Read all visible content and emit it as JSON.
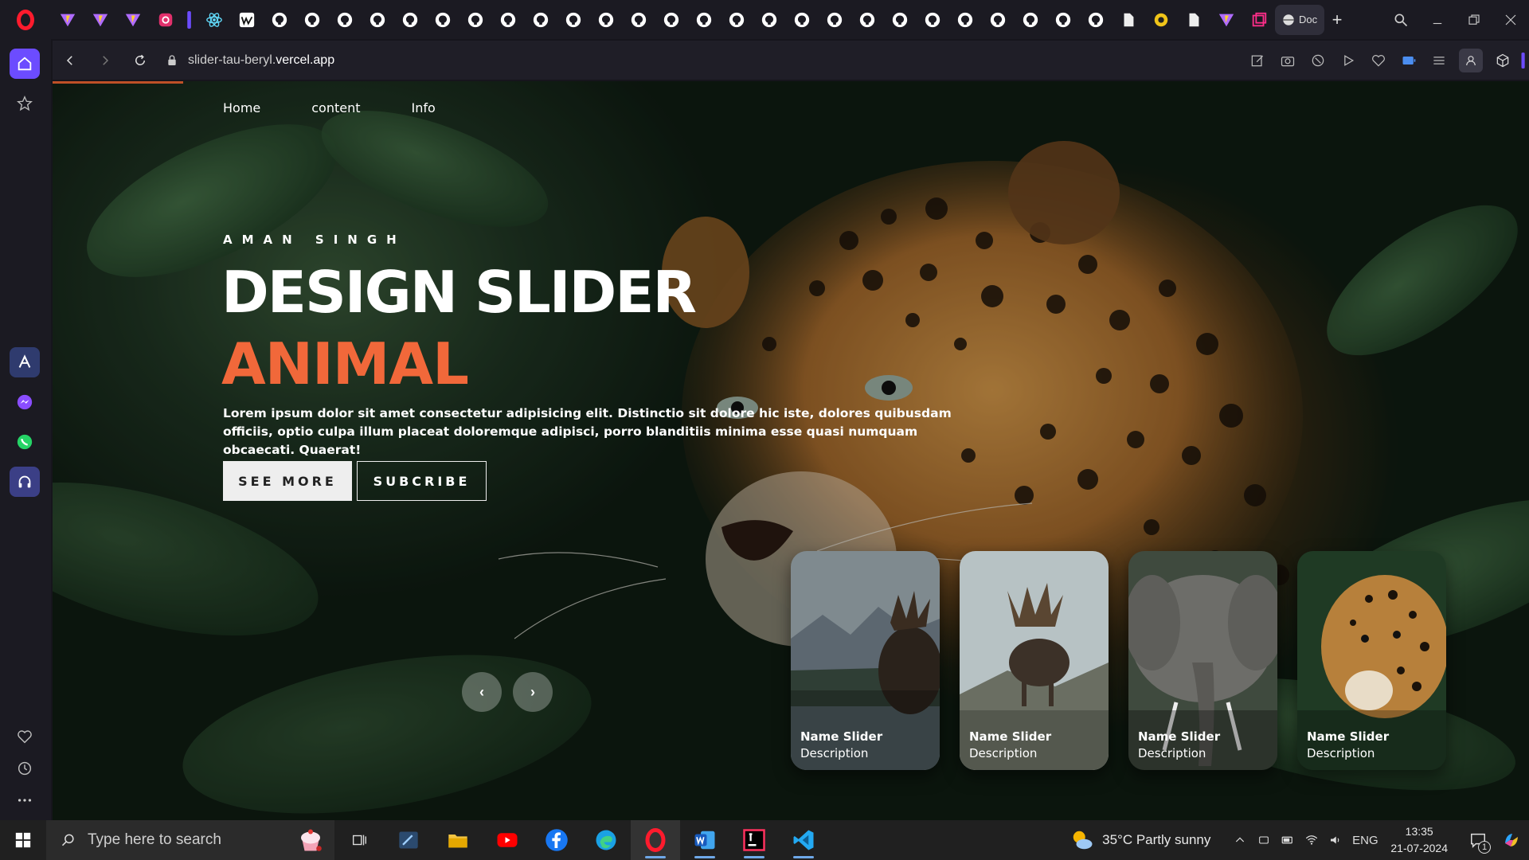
{
  "browser": {
    "address": {
      "prefix": "slider-tau-beryl.",
      "host": "vercel.app"
    },
    "active_tab_label": "Doc",
    "new_tab_symbol": "+"
  },
  "site": {
    "nav": [
      "Home",
      "content",
      "Info"
    ],
    "author": "AMAN SINGH",
    "title": "DESIGN SLIDER",
    "topic": "ANIMAL",
    "description": "Lorem ipsum dolor sit amet consectetur adipisicing elit. Distinctio sit dolore hic iste, dolores quibusdam officiis, optio culpa illum placeat doloremque adipisci, porro blanditiis minima esse quasi numquam obcaecati. Quaerat!",
    "buttons": {
      "see_more": "SEE MORE",
      "subscribe": "SUBCRIBE"
    },
    "arrows": {
      "prev": "‹",
      "next": "›"
    },
    "accent_color": "#f1683a",
    "thumbnails": [
      {
        "name": "Name Slider",
        "description": "Description"
      },
      {
        "name": "Name Slider",
        "description": "Description"
      },
      {
        "name": "Name Slider",
        "description": "Description"
      },
      {
        "name": "Name Slider",
        "description": "Description"
      }
    ]
  },
  "taskbar": {
    "search_placeholder": "Type here to search",
    "weather": "35°C  Partly sunny",
    "language": "ENG",
    "time": "13:35",
    "date": "21-07-2024",
    "notification_count": "1"
  }
}
